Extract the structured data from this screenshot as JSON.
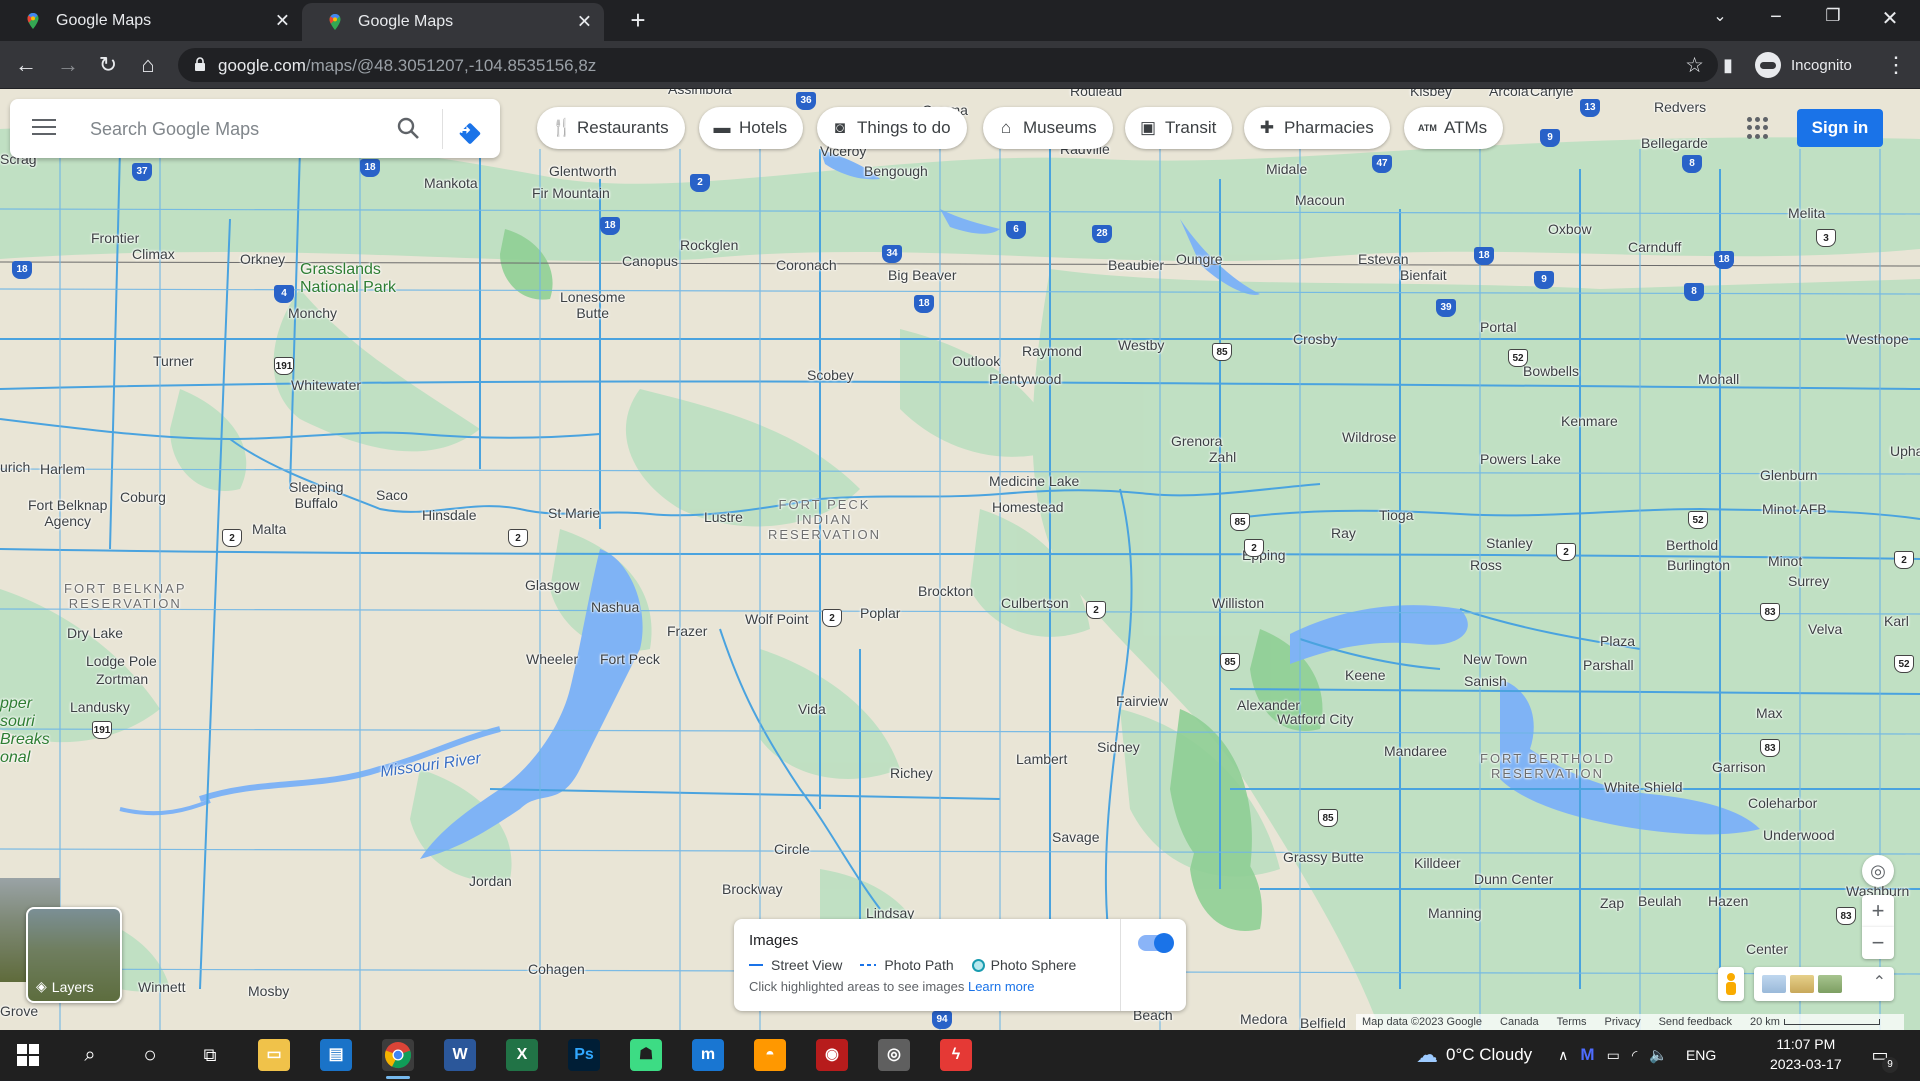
{
  "browser": {
    "tabs": [
      {
        "title": "Google Maps",
        "active": true
      },
      {
        "title": "Google Maps",
        "active": false
      }
    ],
    "url_domain": "google.com",
    "url_path": "/maps/@48.3051207,-104.8535156,8z",
    "profile_label": "Incognito"
  },
  "maps": {
    "search_placeholder": "Search Google Maps",
    "chips": [
      {
        "label": "Restaurants",
        "icon": "fork-knife-icon"
      },
      {
        "label": "Hotels",
        "icon": "bed-icon"
      },
      {
        "label": "Things to do",
        "icon": "camera-icon"
      },
      {
        "label": "Museums",
        "icon": "museum-icon"
      },
      {
        "label": "Transit",
        "icon": "train-icon"
      },
      {
        "label": "Pharmacies",
        "icon": "pharmacy-icon"
      },
      {
        "label": "ATMs",
        "icon": "atm-icon"
      }
    ],
    "signin_label": "Sign in",
    "layers_label": "Layers",
    "images_panel": {
      "title": "Images",
      "legend": [
        "Street View",
        "Photo Path",
        "Photo Sphere"
      ],
      "hint": "Click highlighted areas to see images",
      "learn_more": "Learn more",
      "toggle_on": true
    },
    "attribution": [
      "Map data ©2023 Google",
      "Canada",
      "Terms",
      "Privacy",
      "Send feedback"
    ],
    "scale_label": "20 km",
    "zoom_in": "+",
    "zoom_out": "−",
    "places": {
      "assiniboia": "Assiniboia",
      "ogema": "Ogema",
      "rouleau": "Rouleau",
      "kisbey": "Kisbey",
      "arcola": "Arcola",
      "carlyle": "Carlyle",
      "redvers": "Redvers",
      "glentworth": "Glentworth",
      "mankota": "Mankota",
      "fir_mountain": "Fir Mountain",
      "viceroy": "Viceroy",
      "bengough": "Bengough",
      "radville": "Radville",
      "midale": "Midale",
      "bellegarde": "Bellegarde",
      "frontier": "Frontier",
      "climax": "Climax",
      "orkney": "Orkney",
      "rockglen": "Rockglen",
      "canopus": "Canopus",
      "coronach": "Coronach",
      "big_beaver": "Big Beaver",
      "beaubier": "Beaubier",
      "oungre": "Oungre",
      "macoun": "Macoun",
      "estevan": "Estevan",
      "bienfait": "Bienfait",
      "oxbow": "Oxbow",
      "carnduff": "Carnduff",
      "melita": "Melita",
      "grasslands": "Grasslands\nNational Park",
      "lonesome_butte": "Lonesome\nButte",
      "monchy": "Monchy",
      "turner": "Turner",
      "whitewater": "Whitewater",
      "raymond": "Raymond",
      "outlook": "Outlook",
      "plentywood": "Plentywood",
      "westby": "Westby",
      "scobey": "Scobey",
      "crosby": "Crosby",
      "portal": "Portal",
      "bowbells": "Bowbells",
      "westhope": "Westhope",
      "mohall": "Mohall",
      "harlem": "Harlem",
      "fort_belknap_agency": "Fort Belknap\nAgency",
      "coburg": "Coburg",
      "sleeping_buffalo": "Sleeping\nBuffalo",
      "saco": "Saco",
      "hinsdale": "Hinsdale",
      "malta": "Malta",
      "st_marie": "St Marie",
      "lustre": "Lustre",
      "fort_peck_res": "FORT PECK\nINDIAN\nRESERVATION",
      "medicine_lake": "Medicine Lake",
      "homestead": "Homestead",
      "grenora": "Grenora",
      "zahl": "Zahl",
      "wildrose": "Wildrose",
      "powers_lake": "Powers Lake",
      "kenmare": "Kenmare",
      "glenburn": "Glenburn",
      "minot_afb": "Minot AFB",
      "ray": "Ray",
      "tioga": "Tioga",
      "epping": "Epping",
      "stanley": "Stanley",
      "ross": "Ross",
      "berthold": "Berthold",
      "burlington": "Burlington",
      "minot": "Minot",
      "surrey": "Surrey",
      "fort_belknap_res": "FORT BELKNAP\nRESERVATION",
      "glasgow": "Glasgow",
      "nashua": "Nashua",
      "poplar": "Poplar",
      "brockton": "Brockton",
      "culbertson": "Culbertson",
      "williston": "Williston",
      "wolf_point": "Wolf Point",
      "frazer": "Frazer",
      "dry_lake": "Dry Lake",
      "lodge_pole": "Lodge Pole",
      "zortman": "Zortman",
      "landusky": "Landusky",
      "wheeler": "Wheeler",
      "fort_peck": "Fort Peck",
      "new_town": "New Town",
      "parshall": "Parshall",
      "plaza": "Plaza",
      "keene": "Keene",
      "sanish": "Sanish",
      "velva": "Velva",
      "vida": "Vida",
      "fairview": "Fairview",
      "alexander": "Alexander",
      "watford_city": "Watford City",
      "max": "Max",
      "sidney": "Sidney",
      "mandaree": "Mandaree",
      "fort_berthold_res": "FORT BERTHOLD\nRESERVATION",
      "garrison": "Garrison",
      "missouri_river": "Missouri River",
      "richey": "Richey",
      "lambert": "Lambert",
      "white_shield": "White Shield",
      "coleharbor": "Coleharbor",
      "circle": "Circle",
      "savage": "Savage",
      "grassy_butte": "Grassy Butte",
      "underwood": "Underwood",
      "killdeer": "Killdeer",
      "dunn_center": "Dunn Center",
      "jordan": "Jordan",
      "brockway": "Brockway",
      "zap": "Zap",
      "beulah": "Beulah",
      "hazen": "Hazen",
      "washburn": "Washburn",
      "lindsay": "Lindsay",
      "manning": "Manning",
      "center": "Center",
      "winnett": "Winnett",
      "mosby": "Mosby",
      "cohagen": "Cohagen",
      "grove": "Grove",
      "beach": "Beach",
      "medora": "Medora",
      "belfield": "Belfield",
      "scrag": "Scrag",
      "zurich": "urich",
      "upham": "Upham",
      "karl": "Karl",
      "upper_missouri": "pper\nsouri\nBreaks\nonal"
    },
    "shields": {
      "s36": "36",
      "s37": "37",
      "s18a": "18",
      "s18b": "18",
      "s18c": "18",
      "s18d": "18",
      "s18e": "18",
      "s18f": "18",
      "s2a": "2",
      "s13": "13",
      "s9a": "9",
      "s9b": "9",
      "s47": "47",
      "s8a": "8",
      "s8b": "8",
      "s6": "6",
      "s28": "28",
      "s34": "34",
      "s4": "4",
      "s39": "39",
      "s3": "3",
      "s191a": "191",
      "s191b": "191",
      "s85a": "85",
      "s85b": "85",
      "s85c": "85",
      "s85d": "85",
      "s52a": "52",
      "s52b": "52",
      "s52c": "52",
      "s2b": "2",
      "s2c": "2",
      "s2d": "2",
      "s2e": "2",
      "s2f": "2",
      "s2g": "2",
      "s2h": "2",
      "s83a": "83",
      "s83b": "83",
      "s83c": "83",
      "s83d": "83",
      "s94": "94"
    }
  },
  "taskbar": {
    "weather": "0°C  Cloudy",
    "lang": "ENG",
    "time": "11:07 PM",
    "date": "2023-03-17",
    "notif_count": "9",
    "apps": [
      "windows-start",
      "search",
      "cortana",
      "task-view",
      "file-explorer",
      "outlook-app",
      "chrome",
      "word",
      "excel",
      "photoshop",
      "android-app",
      "mu-app",
      "vpn-app",
      "monster-app",
      "media-app",
      "flash-app"
    ]
  }
}
